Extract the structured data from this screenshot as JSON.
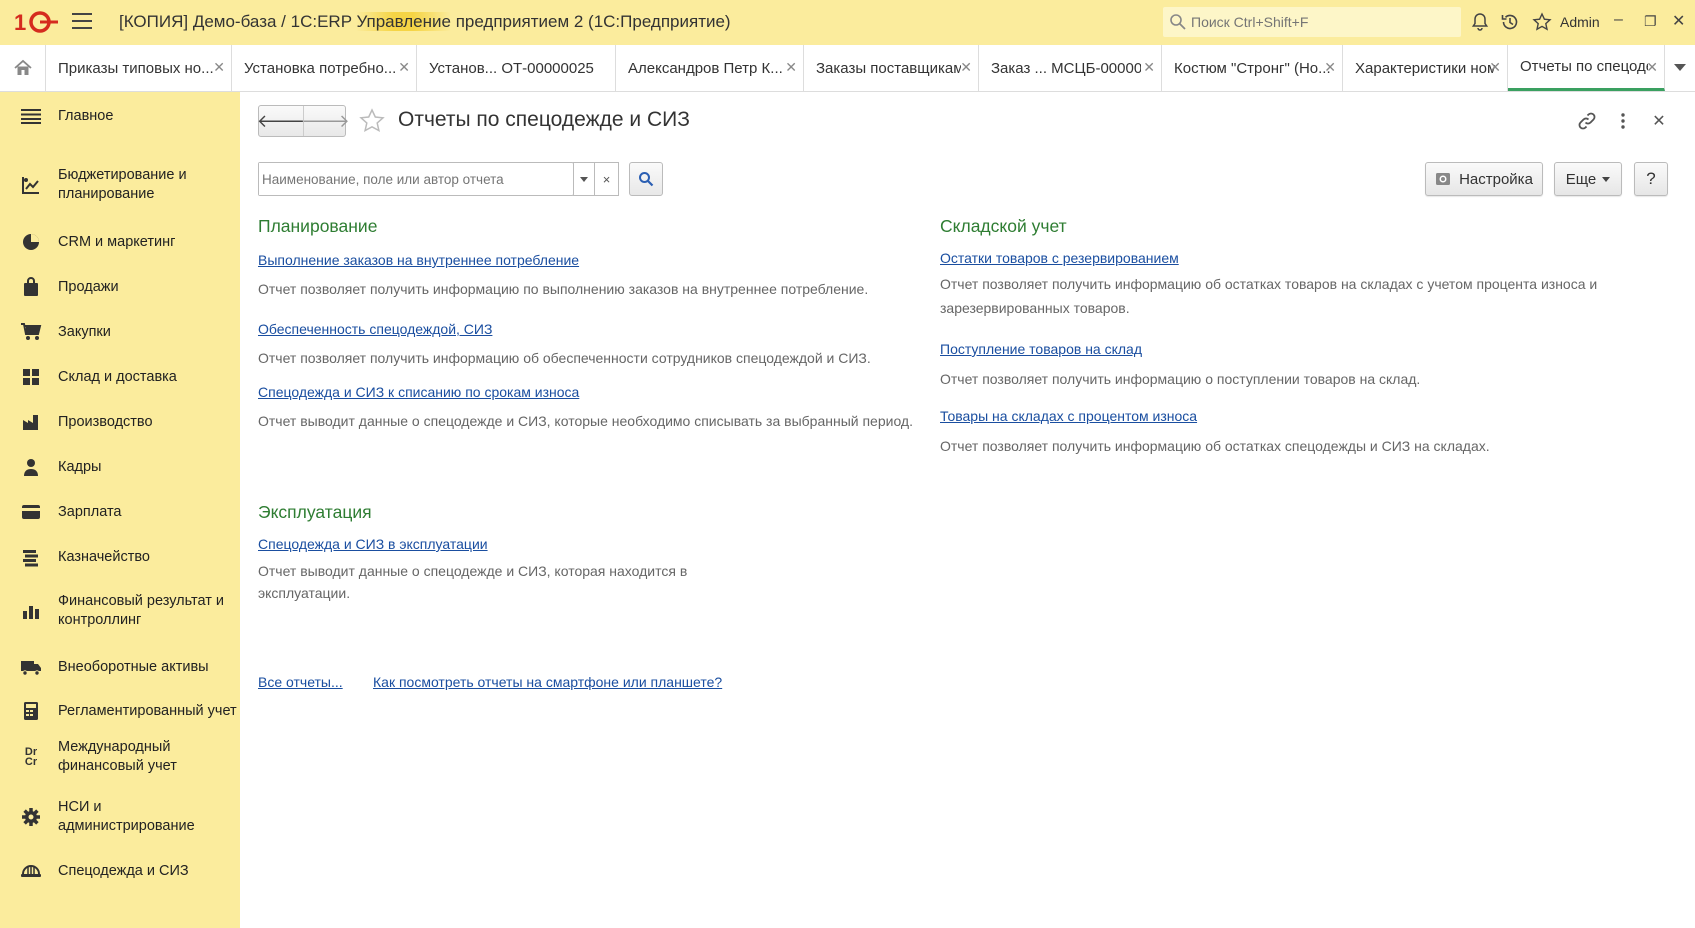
{
  "window": {
    "app_title_pre": "[КОПИЯ] Демо-база / 1С:ERP ",
    "app_title_hl": "Управление",
    "app_title_post": " предприятием 2  (1С:Предприятие)",
    "search_placeholder": "Поиск Ctrl+Shift+F",
    "user": "Admin",
    "highlight_color": "#f5d445"
  },
  "tabs": [
    {
      "label": "Приказы типовых но..."
    },
    {
      "label": "Установка потребно..."
    },
    {
      "label": "Установ... ОТ-00000025"
    },
    {
      "label": "Александров Петр К..."
    },
    {
      "label": "Заказы поставщикам"
    },
    {
      "label": "Заказ ... МСЦБ-00000"
    },
    {
      "label": "Костюм \"Стронг\" (Но..."
    },
    {
      "label": "Характеристики ном..."
    },
    {
      "label": "Отчеты по спецоде..."
    }
  ],
  "sidebar": {
    "items": [
      {
        "label": "Главное",
        "icon": "menu-lines-icon"
      },
      {
        "label": "Бюджетирование и планирование",
        "icon": "budget-icon"
      },
      {
        "label": "CRM и маркетинг",
        "icon": "pie-icon"
      },
      {
        "label": "Продажи",
        "icon": "bag-icon"
      },
      {
        "label": "Закупки",
        "icon": "cart-icon"
      },
      {
        "label": "Склад и доставка",
        "icon": "warehouse-icon"
      },
      {
        "label": "Производство",
        "icon": "factory-icon"
      },
      {
        "label": "Кадры",
        "icon": "person-icon"
      },
      {
        "label": "Зарплата",
        "icon": "card-icon"
      },
      {
        "label": "Казначейство",
        "icon": "coins-icon"
      },
      {
        "label": "Финансовый результат и контроллинг",
        "icon": "bar-chart-icon"
      },
      {
        "label": "Внеоборотные активы",
        "icon": "truck-icon"
      },
      {
        "label": "Регламентированный учет",
        "icon": "calculator-icon"
      },
      {
        "label": "Международный финансовый учет",
        "icon": "dr-cr-icon"
      },
      {
        "label": "НСИ и администрирование",
        "icon": "gear-icon"
      },
      {
        "label": "Спецодежда и СИЗ",
        "icon": "helmet-icon"
      }
    ]
  },
  "page": {
    "title": "Отчеты по спецодежде и СИЗ",
    "filter_placeholder": "Наименование, поле или автор отчета",
    "settings_label": "Настройка",
    "more_label": "Еще",
    "help_label": "?"
  },
  "sections": {
    "planning": {
      "title": "Планирование",
      "reports": [
        {
          "link": "Выполнение заказов на внутреннее потребление",
          "desc": "Отчет позволяет получить информацию по выполнению заказов на внутреннее потребление."
        },
        {
          "link": "Обеспеченность спецодеждой, СИЗ",
          "desc": "Отчет позволяет получить информацию об обеспеченности сотрудников спецодеждой и СИЗ."
        },
        {
          "link": "Спецодежда и СИЗ к списанию по срокам износа",
          "desc": "Отчет выводит данные о спецодежде и СИЗ, которые необходимо списывать за выбранный период."
        }
      ]
    },
    "warehouse": {
      "title": "Складской учет",
      "reports": [
        {
          "link": "Остатки товаров с резервированием",
          "desc": "Отчет позволяет получить информацию об остатках товаров на складах с учетом процента износа и зарезервированных товаров."
        },
        {
          "link": "Поступление товаров на склад",
          "desc": "Отчет позволяет получить информацию о поступлении товаров на склад."
        },
        {
          "link": "Товары на складах с процентом износа",
          "desc": "Отчет позволяет получить информацию об остатках спецодежды и СИЗ на складах."
        }
      ]
    },
    "operation": {
      "title": "Эксплуатация",
      "reports": [
        {
          "link": "Спецодежда и СИЗ в эксплуатации",
          "desc": "Отчет выводит данные о спецодежде и СИЗ, которая находится в эксплуатации."
        }
      ]
    }
  },
  "footer": {
    "all_reports": "Все отчеты...",
    "mobile_help": "Как посмотреть отчеты на смартфоне или планшете?"
  }
}
